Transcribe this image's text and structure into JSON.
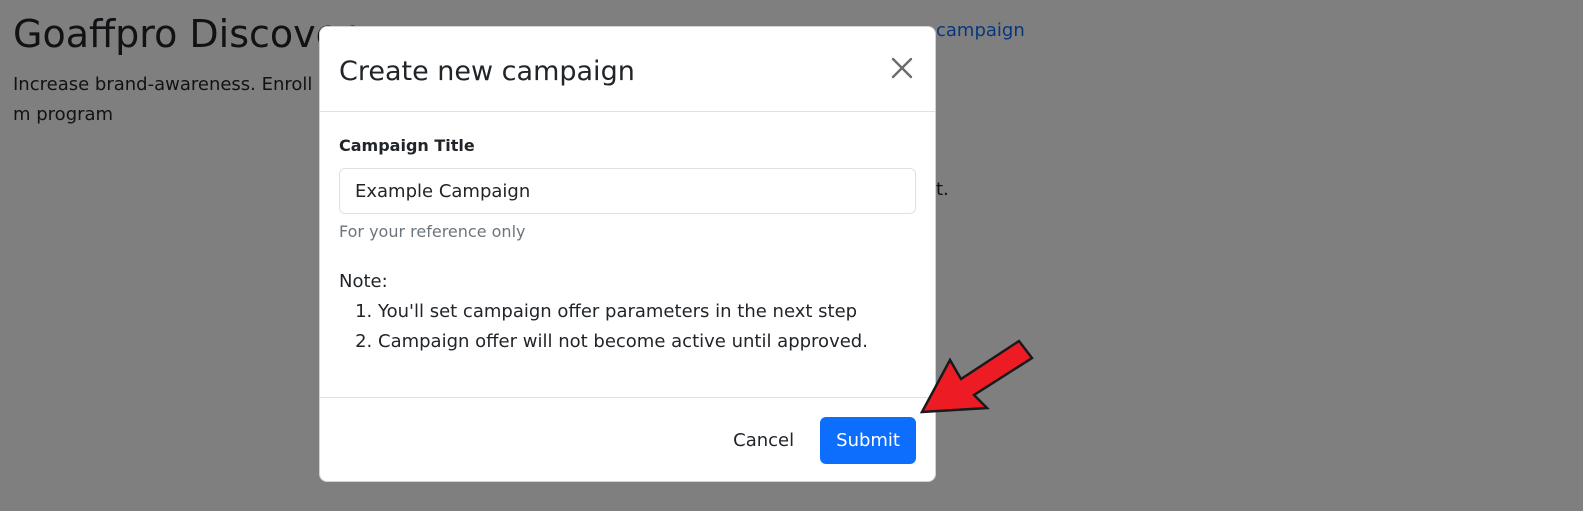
{
  "background": {
    "title": "Goaffpro Discover",
    "description": "Increase brand-awareness. Enroll m program",
    "link_fragment": "campaign",
    "text_fragment": "t."
  },
  "modal": {
    "title": "Create new campaign",
    "close_icon": "close-icon",
    "campaign_title_label": "Campaign Title",
    "campaign_title_value": "Example Campaign",
    "campaign_title_help": "For your reference only",
    "note_label": "Note:",
    "note_items": [
      "You'll set campaign offer parameters in the next step",
      "Campaign offer will not become active until approved."
    ],
    "cancel_label": "Cancel",
    "submit_label": "Submit"
  },
  "colors": {
    "primary": "#0d6efd",
    "backdrop": "rgba(0,0,0,0.5)",
    "annotation_arrow": "#ed1c24"
  },
  "annotation": {
    "icon": "red-arrow-icon"
  }
}
